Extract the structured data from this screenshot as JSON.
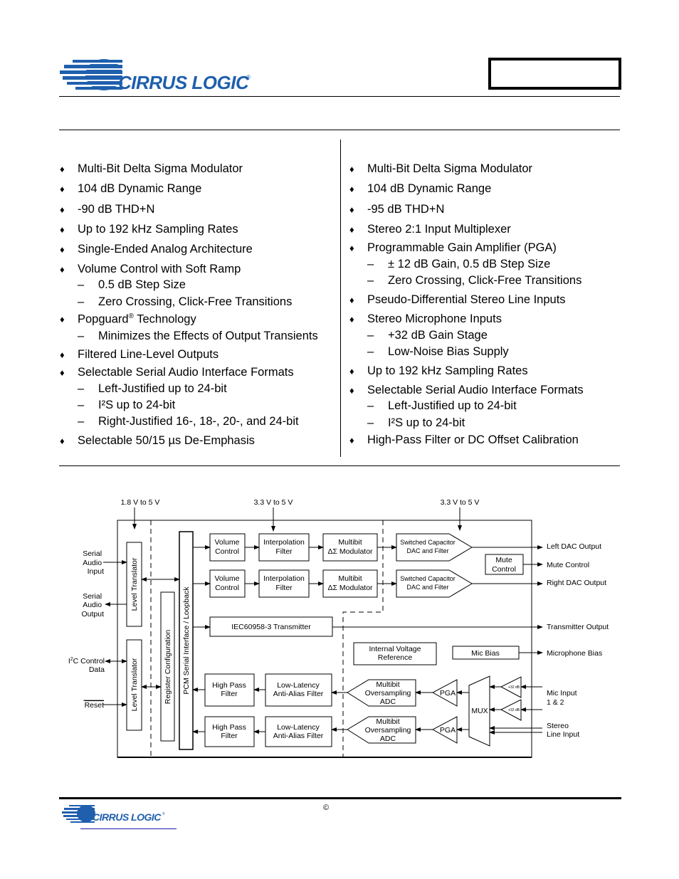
{
  "header": {
    "logo_text": "CIRRUS LOGIC",
    "logo_mark": "®",
    "part_box_text": ""
  },
  "colors": {
    "brand_blue": "#1f5fad",
    "footer_rule_blue": "#1a1aa8"
  },
  "features_left": [
    {
      "text": "Multi-Bit Delta Sigma Modulator",
      "subs": []
    },
    {
      "text": "104 dB Dynamic Range",
      "subs": []
    },
    {
      "text": "-90 dB THD+N",
      "subs": []
    },
    {
      "text": "Up to 192 kHz Sampling Rates",
      "subs": []
    },
    {
      "text": "Single-Ended Analog Architecture",
      "subs": []
    },
    {
      "text": "Volume Control with Soft Ramp",
      "subs": [
        "0.5 dB Step Size",
        "Zero Crossing, Click-Free Transitions"
      ]
    },
    {
      "text": "Popguard",
      "sup": "®",
      "text_after": " Technology",
      "subs": [
        "Minimizes the Effects of Output Transients"
      ]
    },
    {
      "text": "Filtered Line-Level Outputs",
      "subs": []
    },
    {
      "text": "Selectable Serial Audio Interface Formats",
      "subs": [
        "Left-Justified up to 24-bit",
        "I²S up to 24-bit",
        "Right-Justified 16-, 18-, 20-, and 24-bit"
      ]
    },
    {
      "text": "Selectable 50/15 µs De-Emphasis",
      "subs": []
    }
  ],
  "features_right": [
    {
      "text": "Multi-Bit Delta Sigma Modulator",
      "subs": []
    },
    {
      "text": "104 dB Dynamic Range",
      "subs": []
    },
    {
      "text": "-95 dB THD+N",
      "subs": []
    },
    {
      "text": "Stereo 2:1 Input Multiplexer",
      "subs": []
    },
    {
      "text": "Programmable Gain Amplifier (PGA)",
      "subs": [
        "± 12 dB Gain, 0.5 dB Step Size",
        "Zero Crossing, Click-Free Transitions"
      ]
    },
    {
      "text": "Pseudo-Differential Stereo Line Inputs",
      "subs": []
    },
    {
      "text": "Stereo Microphone Inputs",
      "subs": [
        "+32 dB Gain Stage",
        "Low-Noise Bias Supply"
      ]
    },
    {
      "text": "Up to 192 kHz Sampling Rates",
      "subs": []
    },
    {
      "text": "Selectable Serial Audio Interface Formats",
      "subs": [
        "Left-Justified up to 24-bit",
        "I²S up to 24-bit"
      ]
    },
    {
      "text": "High-Pass Filter or DC Offset Calibration",
      "subs": []
    }
  ],
  "bullet_glyph": "♦",
  "dash_glyph": "–",
  "diagram": {
    "supply_1": "1.8 V to 5 V",
    "supply_2": "3.3 V to 5 V",
    "supply_3": "3.3 V to 5 V",
    "serial_audio_input": [
      "Serial",
      "Audio",
      "Input"
    ],
    "serial_audio_output": [
      "Serial",
      "Audio",
      "Output"
    ],
    "i2c_control": "C Control",
    "i2c_prefix": "I",
    "i2c_sup": "2",
    "i2c_data": "Data",
    "reset": "Reset",
    "level_translator": "Level Translator",
    "register_configuration": "Register Configuration",
    "pcm_serial_interface": "PCM Serial Interface / Loopback",
    "volume_control": [
      "Volume",
      "Control"
    ],
    "interpolation_filter": [
      "Interpolation",
      "Filter"
    ],
    "multibit_modulator": [
      "Multibit",
      "ΔΣ Modulator"
    ],
    "switched_cap_dac": [
      "Switched Capacitor",
      "DAC and Filter"
    ],
    "mute_control": [
      "Mute",
      "Control"
    ],
    "iec_transmitter": "IEC60958-3 Transmitter",
    "internal_vref": [
      "Internal Voltage",
      "Reference"
    ],
    "mic_bias": "Mic Bias",
    "high_pass_filter": [
      "High Pass",
      "Filter"
    ],
    "anti_alias_filter": [
      "Low-Latency",
      "Anti-Alias Filter"
    ],
    "oversampling_adc": [
      "Multibit",
      "Oversampling",
      "ADC"
    ],
    "pga": "PGA",
    "mux": "MUX",
    "mic_gain": "+32 dB",
    "outputs": {
      "left_dac": "Left DAC Output",
      "mute_control": "Mute Control",
      "right_dac": "Right DAC Output",
      "transmitter": "Transmitter Output",
      "mic_bias": "Microphone Bias",
      "mic_input": [
        "Mic Input",
        "1 & 2"
      ],
      "line_input": [
        "Stereo",
        "Line Input"
      ]
    }
  },
  "footer": {
    "logo_text": "CIRRUS LOGIC",
    "logo_mark": "®",
    "copyright": "©"
  }
}
